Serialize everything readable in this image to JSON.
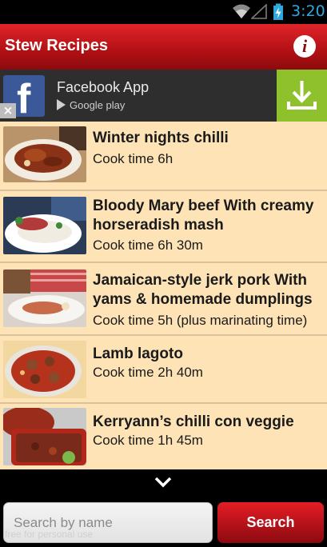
{
  "status": {
    "time": "3:20"
  },
  "app": {
    "title": "Stew Recipes",
    "info_icon_glyph": "i"
  },
  "ad": {
    "title": "Facebook App",
    "store": "Google play",
    "close_glyph": "×",
    "accent_color": "#8fc12c"
  },
  "recipes": [
    {
      "title": "Winter nights chilli",
      "time": "Cook time 6h"
    },
    {
      "title": "Bloody Mary beef With creamy horseradish mash",
      "time": "Cook time 6h 30m"
    },
    {
      "title": "Jamaican-style jerk pork With yams & homemade dumplings",
      "time": "Cook time 5h (plus marinating time)"
    },
    {
      "title": "Lamb lagoto",
      "time": "Cook time 2h 40m"
    },
    {
      "title": "Kerryann’s chilli con veggie",
      "time": "Cook time 1h 45m"
    }
  ],
  "search": {
    "placeholder": "Search by name",
    "button_label": "Search"
  },
  "watermark": "free for personal use",
  "colors": {
    "brand_red": "#b11014",
    "list_bg": "#fde3b6",
    "time_blue": "#2ea8e0"
  }
}
